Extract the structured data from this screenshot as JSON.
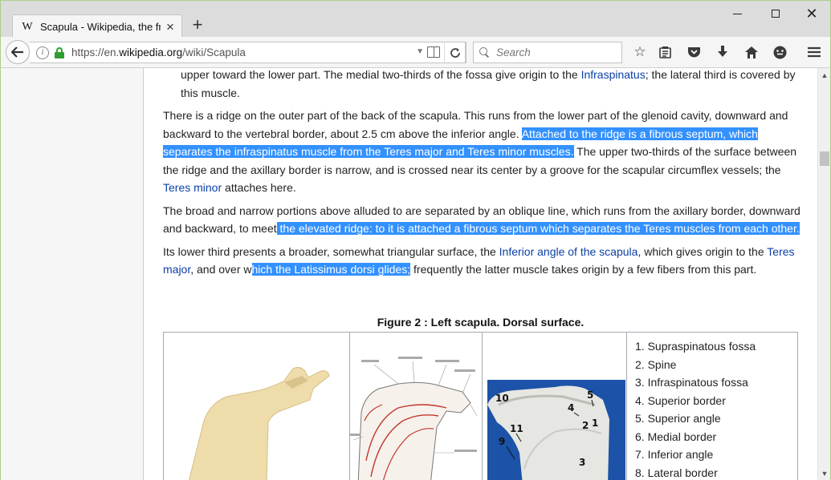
{
  "browser": {
    "tab_title": "Scapula - Wikipedia, the fr...",
    "tab_favicon": "W",
    "url_prefix": "https://en.",
    "url_domain": "wikipedia.org",
    "url_path": "/wiki/Scapula",
    "search_placeholder": "Search",
    "icons": [
      "back-arrow-icon",
      "info-icon",
      "lock-icon",
      "reader-view-icon",
      "reload-icon",
      "search-icon",
      "bookmark-star-icon",
      "reading-list-icon",
      "pocket-icon",
      "download-icon",
      "home-icon",
      "feedback-icon",
      "menu-icon"
    ]
  },
  "article": {
    "p0": {
      "t1": "upper toward the lower part. The medial two-thirds of the fossa give origin to the ",
      "link1": "Infraspinatus",
      "t2": "; the lateral third is covered by this muscle."
    },
    "p1": {
      "t1": "There is a ridge on the outer part of the back of the scapula. This runs from the lower part of the glenoid cavity, downward and backward to the vertebral border, about 2.5 cm above the inferior angle. ",
      "sel1": "Attached to the ridge is a fibrous septum, which separates the infraspinatus muscle from the Teres major and Teres minor muscles.",
      "t2": " The upper two-thirds of the surface between the ridge and the axillary border is narrow, and is crossed near its center by a groove for the scapular circumflex vessels; the ",
      "link1": "Teres minor",
      "t3": " attaches here."
    },
    "p2": {
      "t1": "The broad and narrow portions above alluded to are separated by an oblique line, which runs from the axillary border, downward and backward, to meet",
      "sel1": " the elevated ridge: to it is attached a fibrous septum which separates the Teres muscles from each other."
    },
    "p3": {
      "t1": "Its lower third presents a broader, somewhat triangular surface, the ",
      "link1": "Inferior angle of the scapula",
      "t2": ", which gives origin to the ",
      "link2": "Teres major",
      "t3": ", and over w",
      "sel1": "hich the Latissimus dorsi glides;",
      "t4": " frequently the latter muscle takes origin by a few fibers from this part."
    }
  },
  "figure": {
    "caption": "Figure 2 : Left scapula. Dorsal surface.",
    "photo_labels": [
      "10",
      "5",
      "4",
      "11",
      "2",
      "1",
      "9",
      "3"
    ],
    "legend": [
      {
        "num": "1.",
        "label": "Supraspinatous fossa"
      },
      {
        "num": "2.",
        "label": "Spine"
      },
      {
        "num": "3.",
        "label": "Infraspinatous fossa"
      },
      {
        "num": "4.",
        "label": "Superior border"
      },
      {
        "num": "5.",
        "label": "Superior angle"
      },
      {
        "num": "6.",
        "label": "Medial border"
      },
      {
        "num": "7.",
        "label": "Inferior angle"
      },
      {
        "num": "8.",
        "label": "Lateral border"
      }
    ]
  }
}
